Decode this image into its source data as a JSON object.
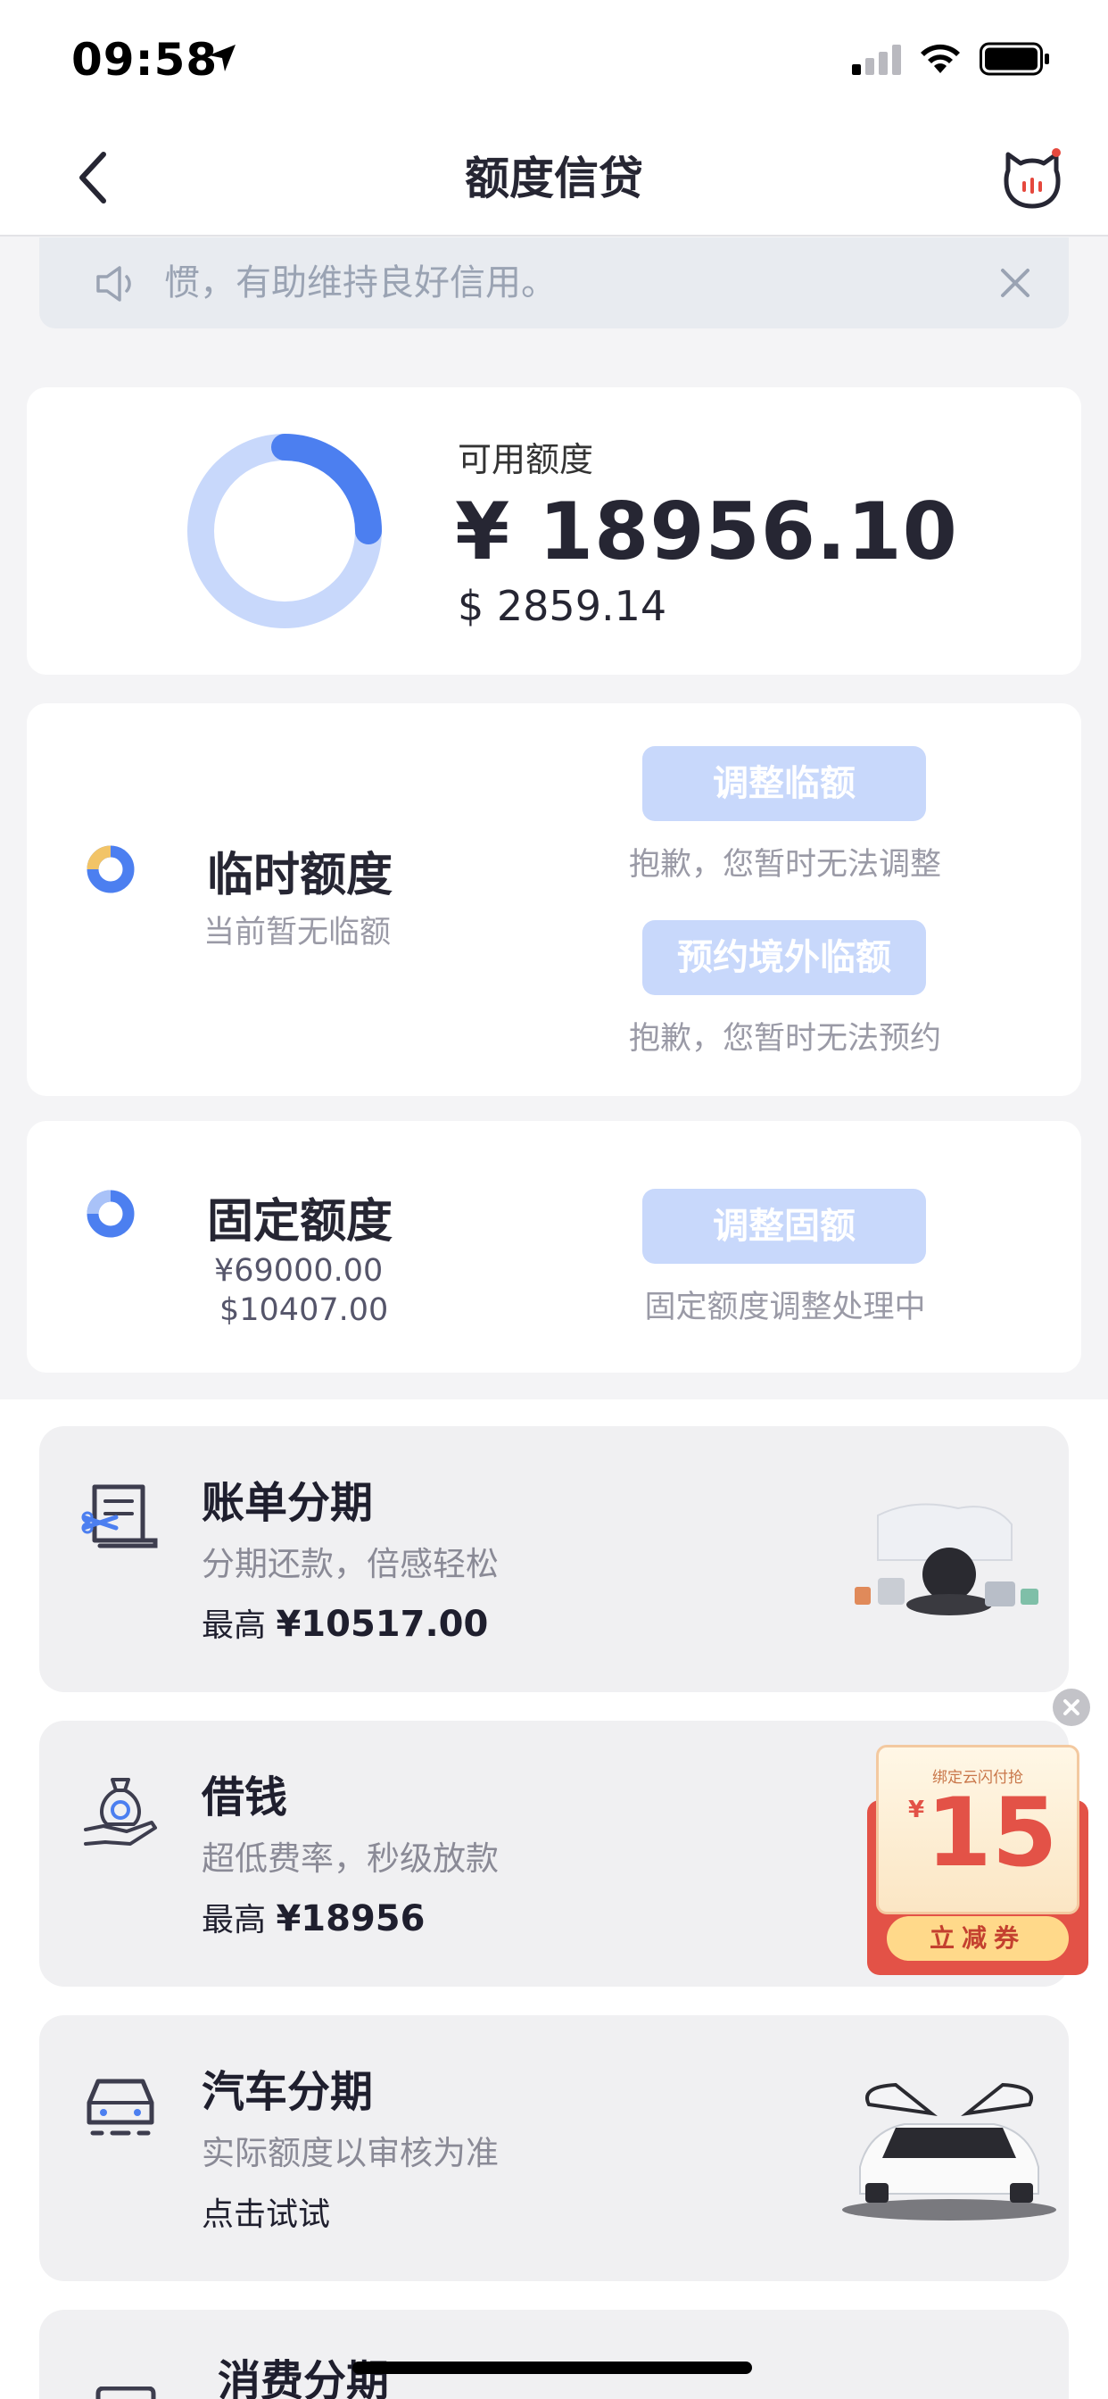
{
  "status_bar": {
    "time": "09:58"
  },
  "nav": {
    "title": "额度信贷"
  },
  "notice": {
    "text": "惯，有助维持良好信用。"
  },
  "available": {
    "label": "可用额度",
    "cny": "¥ 18956.10",
    "usd": "$ 2859.14",
    "ring_fraction": 0.25,
    "ring_color": "#4c7ff0",
    "ring_track_color": "#c8d8fb"
  },
  "temp_limit": {
    "title": "临时额度",
    "sub": "当前暂无临额",
    "btn_adjust": "调整临额",
    "note_adjust": "抱歉，您暂时无法调整",
    "btn_reserve": "预约境外临额",
    "note_reserve": "抱歉，您暂时无法预约"
  },
  "fixed_limit": {
    "title": "固定额度",
    "cny": "¥69000.00",
    "usd": "$10407.00",
    "btn": "调整固额",
    "note": "固定额度调整处理中"
  },
  "services": [
    {
      "title": "账单分期",
      "sub": "分期还款，倍感轻松",
      "prefix": "最高",
      "value": "¥10517.00"
    },
    {
      "title": "借钱",
      "sub": "超低费率，秒级放款",
      "prefix": "最高",
      "value": "¥18956"
    },
    {
      "title": "汽车分期",
      "sub": "实际额度以审核为准",
      "prefix": "点击试试",
      "value": ""
    },
    {
      "title": "消费分期"
    }
  ],
  "coupon": {
    "top": "绑定云闪付抢",
    "currency": "¥",
    "amount": "15",
    "label": "立减券"
  }
}
